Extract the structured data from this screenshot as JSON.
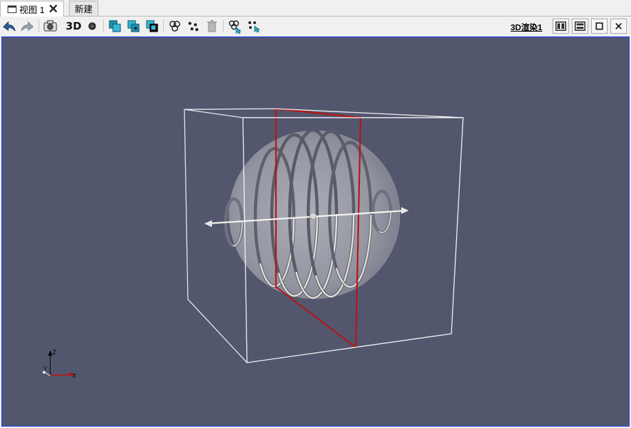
{
  "tabs": {
    "active_label": "视图 1",
    "close_glyph": "✕",
    "new_label": "新建"
  },
  "toolbar": {
    "label_3d": "3D",
    "render_view_label": "3D渲染1",
    "icons": [
      "undo-camera-icon",
      "redo-camera-icon",
      "screenshot-icon",
      "3d-toggle",
      "point-icon",
      "select-surface-cells-icon",
      "select-surface-points-icon",
      "select-frustum-cells-icon",
      "select-cells-on-icon",
      "select-points-on-icon",
      "clear-selection-icon",
      "interactive-select-cells-icon",
      "interactive-select-points-icon"
    ],
    "window_buttons": [
      "split-horizontal-icon",
      "split-vertical-icon",
      "maximize-icon",
      "close-icon"
    ]
  },
  "viewport": {
    "background": "#52576e",
    "axes": {
      "z": "Z",
      "y": "Y",
      "x": "X"
    },
    "colors": {
      "box": "#ffffff",
      "plane": "#bb1111",
      "sphere": "#c8c8cc",
      "helix": "#d8d8d0"
    }
  }
}
